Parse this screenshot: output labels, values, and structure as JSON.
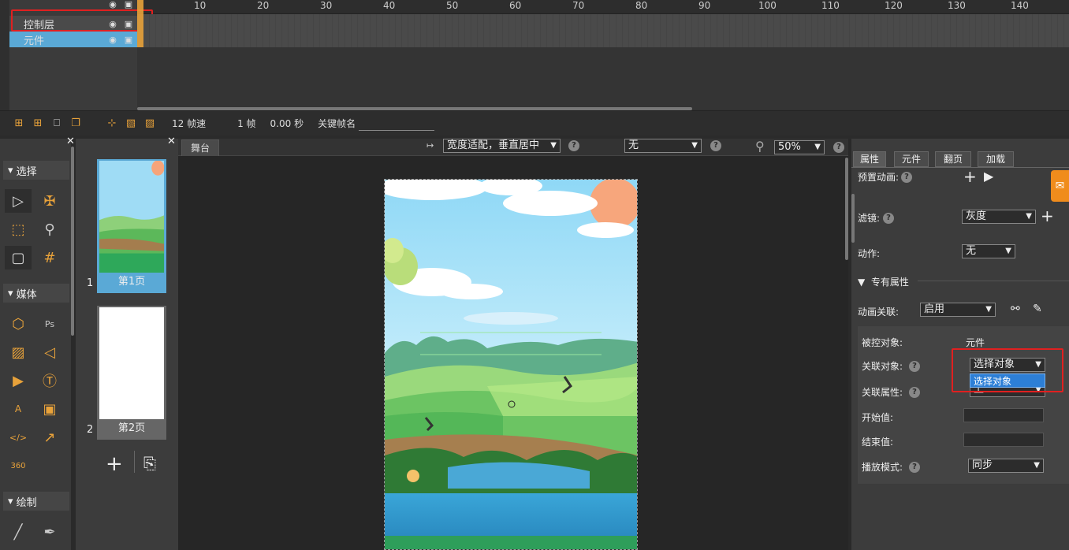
{
  "timeline": {
    "layers": [
      {
        "name": "控制层"
      },
      {
        "name": "元件"
      }
    ],
    "ruler_labels": [
      "10",
      "20",
      "30",
      "40",
      "50",
      "60",
      "70",
      "80",
      "90",
      "100",
      "110",
      "120",
      "130",
      "140"
    ],
    "fps_label": "12 帧速",
    "frame_label": "1 帧",
    "time_label": "0.00 秒",
    "keyframe_label": "关键帧名"
  },
  "tools": {
    "sections": {
      "select": "选择",
      "media": "媒体",
      "draw": "绘制"
    },
    "icon_360": "360"
  },
  "pages": {
    "items": [
      {
        "num": "1",
        "label": "第1页"
      },
      {
        "num": "2",
        "label": "第2页"
      }
    ]
  },
  "stage": {
    "tab": "舞台",
    "fit_select": "宽度适配，垂直居中",
    "bg_select": "无",
    "zoom_select": "50%",
    "help": "?"
  },
  "props": {
    "tabs": [
      "属性",
      "元件",
      "翻页",
      "加载"
    ],
    "preset_anim_label": "预置动画:",
    "filter_label": "滤镜:",
    "filter_value": "灰度",
    "action_label": "动作:",
    "action_value": "无",
    "special_title": "专有属性",
    "anim_link_label": "动画关联:",
    "anim_link_value": "启用",
    "controlled_label": "被控对象:",
    "controlled_value": "元件",
    "linked_obj_label": "关联对象:",
    "linked_obj_value": "选择对象",
    "linked_obj_option": "选择对象",
    "linked_prop_label": "关联属性:",
    "linked_prop_value": "上",
    "start_label": "开始值:",
    "end_label": "结束值:",
    "play_mode_label": "播放模式:",
    "play_mode_value": "同步"
  },
  "colors": {
    "accent": "#e8a23a",
    "highlight": "#e02020",
    "select_blue": "#2d7fd6",
    "layer_blue": "#5aa9d6"
  }
}
